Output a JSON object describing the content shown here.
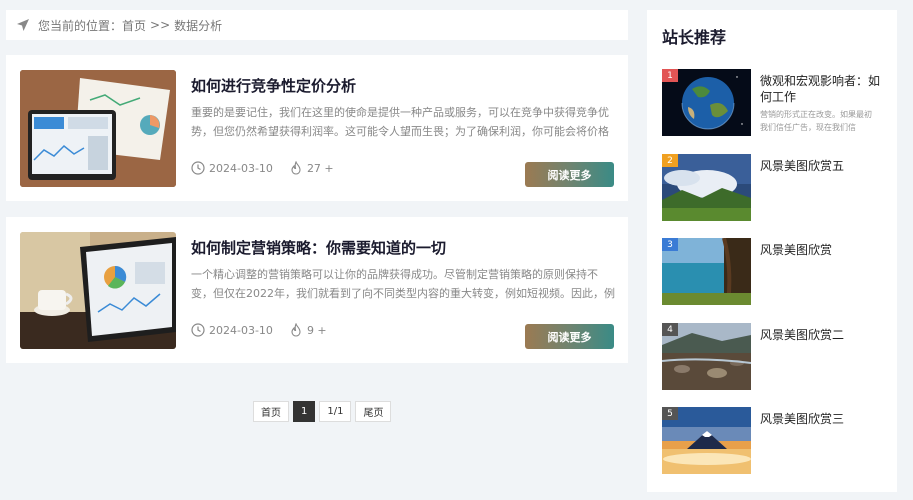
{
  "breadcrumb": {
    "prefix": "您当前的位置：",
    "home": "首页",
    "separator": ">>",
    "current": "数据分析",
    "icon": "location-arrow-icon"
  },
  "articles": [
    {
      "title": "如何进行竞争性定价分析",
      "excerpt": "重要的是要记住，我们在这里的使命是提供一种产品或服务，可以在竞争中获得竞争优势，但您仍然希望获得利润率。这可能令人望而生畏；为了确保利润，你可能会将价格过高，...",
      "date": "2024-03-10",
      "views": "27 +",
      "read_more": "阅读更多"
    },
    {
      "title": "如何制定营销策略：你需要知道的一切",
      "excerpt": "一个精心调整的营销策略可以让你的品牌获得成功。尽管制定营销策略的原则保持不变，但仅在2022年，我们就看到了向不同类型内容的重大转变，例如短视频。因此，例如，你需...",
      "date": "2024-03-10",
      "views": "9 +",
      "read_more": "阅读更多"
    }
  ],
  "pagination": {
    "first": "首页",
    "current": "1",
    "info": "1/1",
    "last": "尾页"
  },
  "sidebar": {
    "title": "站长推荐",
    "items": [
      {
        "rank": "1",
        "rank_color": "#e25555",
        "title": "微观和宏观影响者：如何工作",
        "desc": "营销的形式正在改变。如果最初我们信任广告，现在我们信"
      },
      {
        "rank": "2",
        "rank_color": "#f0a020",
        "title": "风景美图欣赏五"
      },
      {
        "rank": "3",
        "rank_color": "#3a7bd5",
        "title": "风景美图欣赏"
      },
      {
        "rank": "4",
        "rank_color": "#555555",
        "title": "风景美图欣赏二"
      },
      {
        "rank": "5",
        "rank_color": "#555555",
        "title": "风景美图欣赏三"
      }
    ]
  },
  "colors": {
    "background": "#f1f4f7",
    "button_gradient_start": "#9b7a52",
    "button_gradient_end": "#3a8b86"
  }
}
